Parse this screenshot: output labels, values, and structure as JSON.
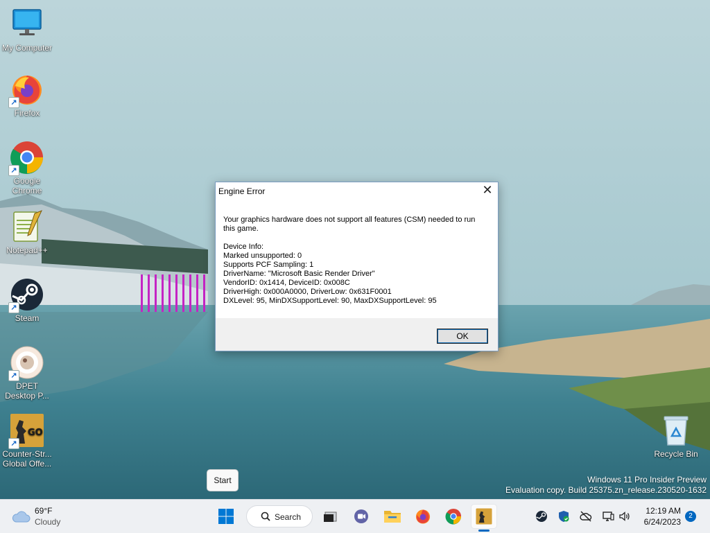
{
  "desktop": {
    "icons": [
      {
        "label": "My Computer",
        "icon": "monitor-icon"
      },
      {
        "label": "Firefox",
        "icon": "firefox-icon"
      },
      {
        "label": "Google Chrome",
        "icon": "chrome-icon"
      },
      {
        "label": "Notepad++",
        "icon": "notepad-plus-plus-icon"
      },
      {
        "label": "Steam",
        "icon": "steam-icon"
      },
      {
        "label": "DPET Desktop P...",
        "icon": "dpet-icon"
      },
      {
        "label": "Counter-Str... Global Offe...",
        "icon": "csgo-icon"
      },
      {
        "label": "Recycle Bin",
        "icon": "recycle-bin-icon"
      }
    ],
    "watermark": {
      "line1": "Windows 11 Pro Insider Preview",
      "line2": "Evaluation copy. Build 25375.zn_release.230520-1632"
    },
    "tooltip": "Start"
  },
  "dialog": {
    "title": "Engine Error",
    "close_glyph": "✕",
    "message": "Your graphics hardware does not support all features (CSM) needed to run this game.",
    "details": [
      "Device Info:",
      "Marked unsupported: 0",
      "Supports PCF Sampling: 1",
      "DriverName: \"Microsoft Basic Render Driver\"",
      "VendorID: 0x1414, DeviceID: 0x008C",
      "DriverHigh: 0x000A0000, DriverLow: 0x631F0001",
      "DXLevel: 95, MinDXSupportLevel: 90, MaxDXSupportLevel: 95"
    ],
    "ok_label": "OK"
  },
  "taskbar": {
    "weather": {
      "temp": "69°F",
      "condition": "Cloudy"
    },
    "search_label": "Search",
    "clock": {
      "time": "12:19 AM",
      "date": "6/24/2023"
    },
    "notification_count": "2",
    "accent": "#0067c0"
  }
}
